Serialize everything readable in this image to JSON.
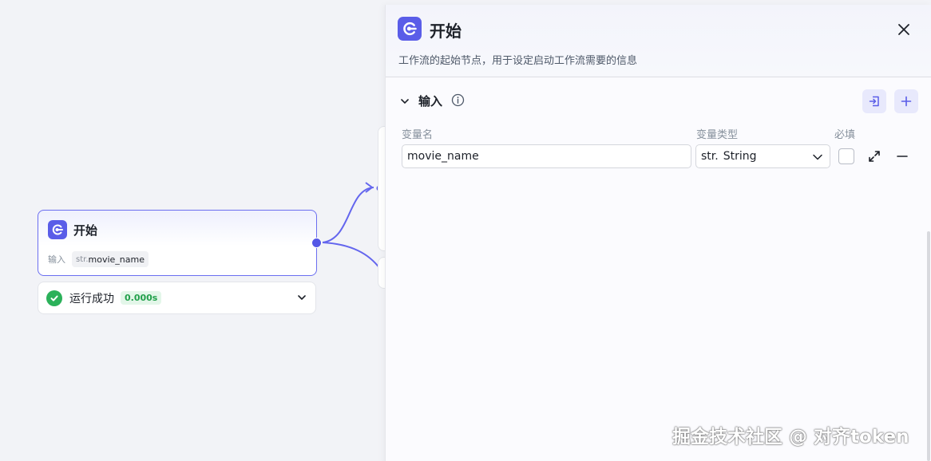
{
  "node": {
    "title": "开始",
    "input_label": "输入",
    "input_type": "str.",
    "input_var": "movie_name"
  },
  "status": {
    "text": "运行成功",
    "time": "0.000s"
  },
  "panel": {
    "title": "开始",
    "description": "工作流的起始节点，用于设定启动工作流需要的信息",
    "section_title": "输入",
    "columns": {
      "name": "变量名",
      "type": "变量类型",
      "required": "必填"
    },
    "row": {
      "name_value": "movie_name",
      "type_prefix": "str.",
      "type_value": "String",
      "required": false
    }
  },
  "watermark": "掘金技术社区 @ 对齐token",
  "colors": {
    "accent": "#5a5de8",
    "success": "#2bb15a",
    "canvas": "#f2f3f7"
  },
  "icons": {
    "node_logo": "start-icon",
    "close": "close-icon",
    "info": "info-icon",
    "import": "import-icon",
    "add": "plus-icon",
    "expand": "expand-icon",
    "remove": "minus-icon"
  }
}
